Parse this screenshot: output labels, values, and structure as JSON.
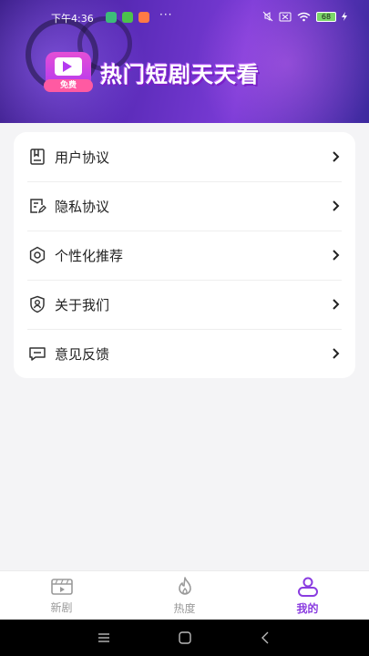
{
  "status_bar": {
    "time": "下午4:36",
    "more": "···",
    "battery": "68"
  },
  "banner": {
    "logo_tag": "免费",
    "title": "热门短剧天天看"
  },
  "menu": {
    "items": [
      {
        "label": "用户协议",
        "icon": "book-icon"
      },
      {
        "label": "隐私协议",
        "icon": "document-edit-icon"
      },
      {
        "label": "个性化推荐",
        "icon": "gear-icon"
      },
      {
        "label": "关于我们",
        "icon": "user-shield-icon"
      },
      {
        "label": "意见反馈",
        "icon": "message-icon"
      }
    ]
  },
  "tabbar": {
    "tabs": [
      {
        "label": "新剧",
        "icon": "film-icon",
        "active": false
      },
      {
        "label": "热度",
        "icon": "flame-icon",
        "active": false
      },
      {
        "label": "我的",
        "icon": "profile-icon",
        "active": true
      }
    ]
  },
  "colors": {
    "accent": "#8a3ce0",
    "banner_start": "#3a1e88",
    "banner_end": "#7a3bd6",
    "page_bg": "#f4f4f6"
  }
}
